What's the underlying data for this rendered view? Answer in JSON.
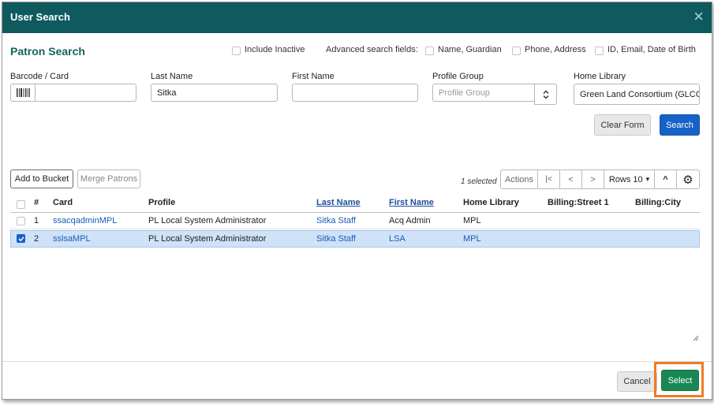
{
  "dialog": {
    "title": "User Search",
    "close_glyph": "×"
  },
  "search": {
    "section_title": "Patron Search",
    "include_inactive": "Include Inactive",
    "advanced_label": "Advanced search fields:",
    "adv_name_guardian": "Name, Guardian",
    "adv_phone_address": "Phone, Address",
    "adv_id_email_dob": "ID, Email, Date of Birth",
    "barcode_label": "Barcode / Card",
    "barcode_value": "",
    "last_name_label": "Last Name",
    "last_name_value": "Sitka",
    "first_name_label": "First Name",
    "first_name_value": "",
    "profile_group_label": "Profile Group",
    "profile_group_placeholder": "Profile Group",
    "home_library_label": "Home Library",
    "home_library_value": "Green Land Consortium (GLCC",
    "clear_form": "Clear Form",
    "search_button": "Search"
  },
  "toolbar": {
    "add_to_bucket": "Add to Bucket",
    "merge_patrons": "Merge Patrons",
    "selected_text": "1 selected",
    "actions": "Actions",
    "first_page": "|<",
    "prev_page": "<",
    "next_page": ">",
    "rows": "Rows 10",
    "rows_caret": "▾",
    "collapse": "^",
    "gear": "⚙"
  },
  "table": {
    "headers": {
      "num": "#",
      "card": "Card",
      "profile": "Profile",
      "last_name": "Last Name",
      "first_name": "First Name",
      "home_library": "Home Library",
      "street": "Billing:Street 1",
      "city": "Billing:City"
    },
    "rows": [
      {
        "num": "1",
        "card": "ssacqadminMPL",
        "profile": "PL Local System Administrator",
        "last_name": "Sitka Staff",
        "first_name": "Acq Admin",
        "home_library": "MPL",
        "selected": false
      },
      {
        "num": "2",
        "card": "sslsaMPL",
        "profile": "PL Local System Administrator",
        "last_name": "Sitka Staff",
        "first_name": "LSA",
        "home_library": "MPL",
        "selected": true
      }
    ]
  },
  "footer": {
    "cancel": "Cancel",
    "select": "Select"
  },
  "colors": {
    "header_bg": "#0e5a5f",
    "section_title": "#15655d",
    "primary": "#1762c6",
    "select_green": "#198754",
    "selected_row": "#cfe2f7",
    "highlight_box": "#ee7c24"
  }
}
